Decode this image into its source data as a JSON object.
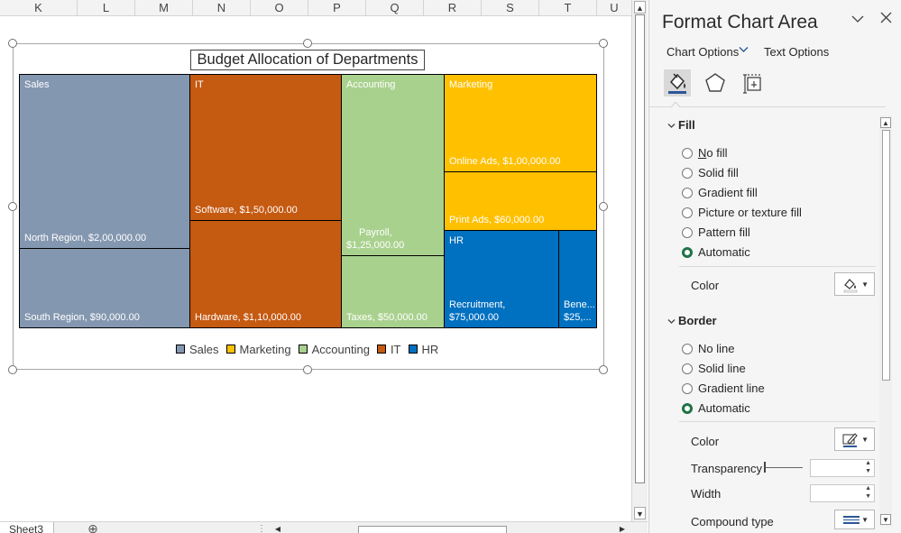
{
  "sheet": {
    "columns": [
      "K",
      "L",
      "M",
      "N",
      "O",
      "P",
      "Q",
      "R",
      "S",
      "T",
      "U"
    ],
    "tab_name": "Sheet3",
    "add_sheet_symbol": "⊕",
    "split_symbol": "⋮"
  },
  "chart": {
    "title": "Budget Allocation of Departments",
    "tiles": [
      {
        "category": "Sales",
        "label": "North Region,  $2,00,000.00",
        "color": "#8497b0"
      },
      {
        "category": "",
        "label": "South Region,  $90,000.00",
        "color": "#8497b0"
      },
      {
        "category": "IT",
        "label": "Software,  $1,50,000.00",
        "color": "#c55a11"
      },
      {
        "category": "",
        "label": "Hardware,  $1,10,000.00",
        "color": "#c55a11"
      },
      {
        "category": "Accounting",
        "label": "Payroll,",
        "label2": "$1,25,000.00",
        "color": "#a9d18e"
      },
      {
        "category": "",
        "label": "Taxes,  $50,000.00",
        "color": "#a9d18e"
      },
      {
        "category": "Marketing",
        "label": "Online Ads,  $1,00,000.00",
        "color": "#ffc000"
      },
      {
        "category": "",
        "label": "Print Ads,  $60,000.00",
        "color": "#ffc000"
      },
      {
        "category": "HR",
        "label": "Recruitment,",
        "label2": " $75,000.00",
        "color": "#0070c0"
      },
      {
        "category": "",
        "label": "Bene...",
        "label2": "$25,...",
        "color": "#0070c0"
      }
    ],
    "legend": [
      {
        "name": "Sales",
        "color": "#8497b0"
      },
      {
        "name": "Marketing",
        "color": "#ffc000"
      },
      {
        "name": "Accounting",
        "color": "#a9d18e"
      },
      {
        "name": "IT",
        "color": "#c55a11"
      },
      {
        "name": "HR",
        "color": "#0070c0"
      }
    ]
  },
  "chart_data": {
    "type": "treemap",
    "title": "Budget Allocation of Departments",
    "series": [
      {
        "name": "Sales",
        "items": [
          {
            "label": "North Region",
            "value": 200000
          },
          {
            "label": "South Region",
            "value": 90000
          }
        ]
      },
      {
        "name": "IT",
        "items": [
          {
            "label": "Software",
            "value": 150000
          },
          {
            "label": "Hardware",
            "value": 110000
          }
        ]
      },
      {
        "name": "Accounting",
        "items": [
          {
            "label": "Payroll",
            "value": 125000
          },
          {
            "label": "Taxes",
            "value": 50000
          }
        ]
      },
      {
        "name": "Marketing",
        "items": [
          {
            "label": "Online Ads",
            "value": 100000
          },
          {
            "label": "Print Ads",
            "value": 60000
          }
        ]
      },
      {
        "name": "HR",
        "items": [
          {
            "label": "Recruitment",
            "value": 75000
          },
          {
            "label": "Bene...",
            "value": 25000
          }
        ]
      }
    ],
    "legend": "bottom"
  },
  "pane": {
    "title": "Format Chart Area",
    "tabs": {
      "chart_options": "Chart Options",
      "text_options": "Text Options"
    },
    "fill": {
      "heading": "Fill",
      "options": [
        {
          "label": "No fill",
          "key": "N",
          "selected": false
        },
        {
          "label": "Solid fill",
          "key": "S",
          "selected": false
        },
        {
          "label": "Gradient fill",
          "key": "G",
          "selected": false
        },
        {
          "label": "Picture or texture fill",
          "key": "P",
          "selected": false
        },
        {
          "label": "Pattern fill",
          "key": "A",
          "selected": false
        },
        {
          "label": "Automatic",
          "key": "U",
          "selected": true
        }
      ],
      "color_label": "Color"
    },
    "border": {
      "heading": "Border",
      "options": [
        {
          "label": "No line",
          "key": "N",
          "selected": false
        },
        {
          "label": "Solid line",
          "key": "S",
          "selected": false
        },
        {
          "label": "Gradient line",
          "key": "G",
          "selected": false
        },
        {
          "label": "Automatic",
          "key": "U",
          "selected": true
        }
      ],
      "color_label": "Color",
      "transparency_label": "Transparency",
      "width_label": "Width",
      "compound_label": "Compound type"
    }
  }
}
